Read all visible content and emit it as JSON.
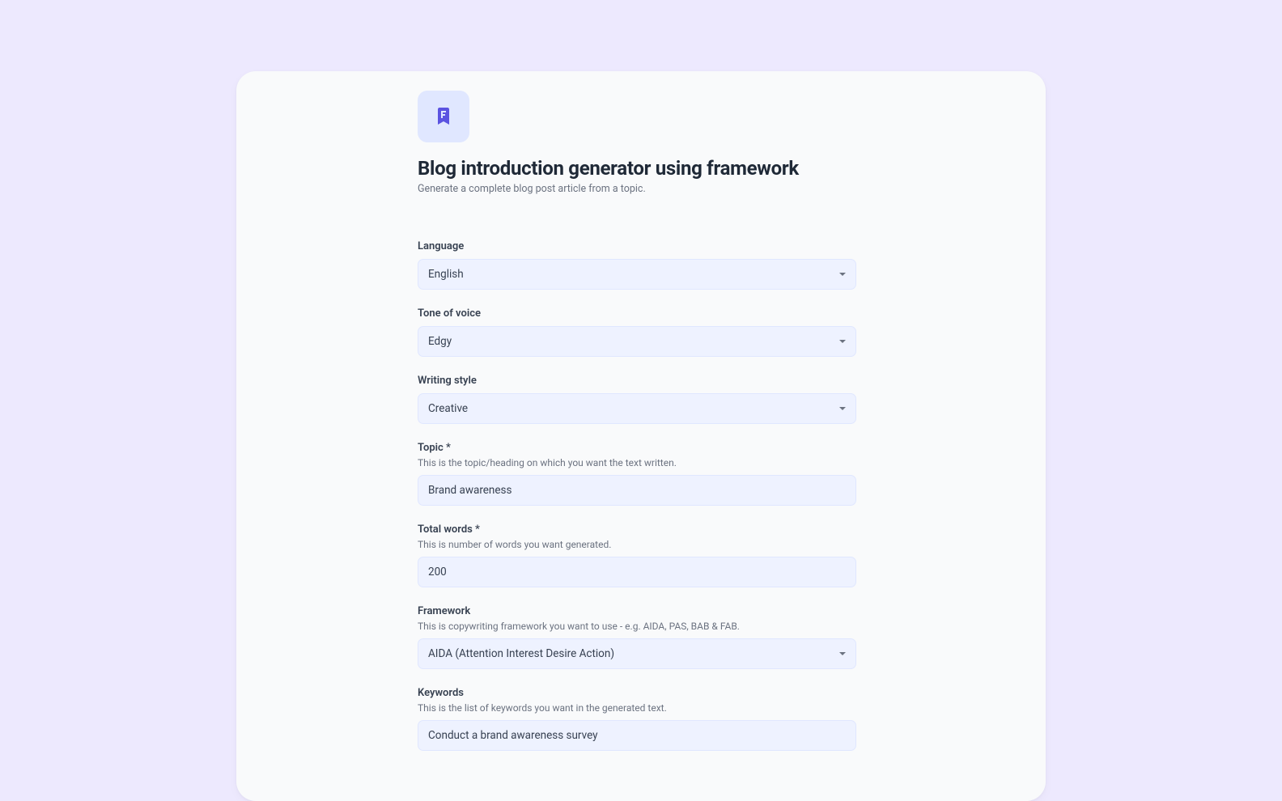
{
  "header": {
    "title": "Blog introduction generator using framework",
    "subtitle": "Generate a complete blog post article from a topic."
  },
  "form": {
    "language": {
      "label": "Language",
      "value": "English"
    },
    "tone": {
      "label": "Tone of voice",
      "value": "Edgy"
    },
    "style": {
      "label": "Writing style",
      "value": "Creative"
    },
    "topic": {
      "label": "Topic *",
      "description": "This is the topic/heading on which you want the text written.",
      "value": "Brand awareness"
    },
    "totalWords": {
      "label": "Total words *",
      "description": "This is number of words you want generated.",
      "value": "200"
    },
    "framework": {
      "label": "Framework",
      "description": "This is copywriting framework you want to use - e.g. AIDA, PAS, BAB & FAB.",
      "value": "AIDA (Attention Interest Desire Action)"
    },
    "keywords": {
      "label": "Keywords",
      "description": "This is the list of keywords you want in the generated text.",
      "value": "Conduct a brand awareness survey"
    }
  }
}
